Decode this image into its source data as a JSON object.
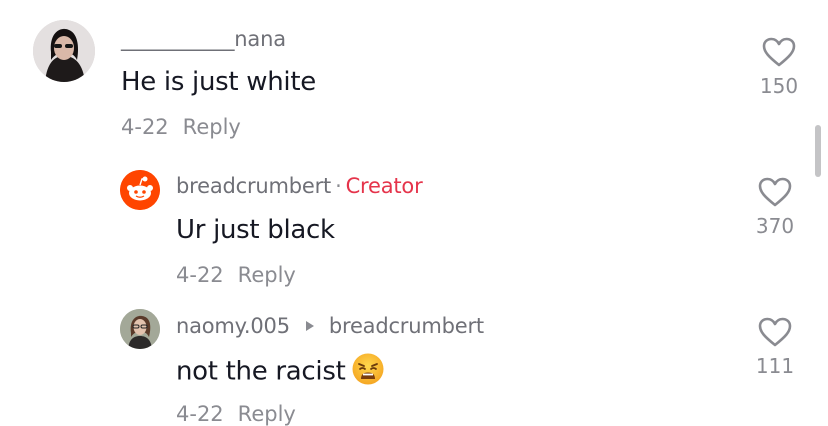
{
  "comments": [
    {
      "username": "___________nana",
      "text": "He is just white",
      "date": "4-22",
      "reply_label": "Reply",
      "likes": "150"
    },
    {
      "username": "breadcrumbert",
      "separator": "·",
      "badge": "Creator",
      "text": "Ur just black",
      "date": "4-22",
      "reply_label": "Reply",
      "likes": "370"
    },
    {
      "username": "naomy.005",
      "reply_to": "breadcrumbert",
      "text": "not the racist",
      "date": "4-22",
      "reply_label": "Reply",
      "likes": "111"
    }
  ],
  "colors": {
    "creator_badge": "#e5344b",
    "reddit_orange": "#ff4500",
    "secondary_text": "#8a8b91"
  },
  "icons": {
    "like": "heart-outline-icon",
    "emoji": "weary-face-emoji",
    "arrow": "caret-right-icon"
  }
}
